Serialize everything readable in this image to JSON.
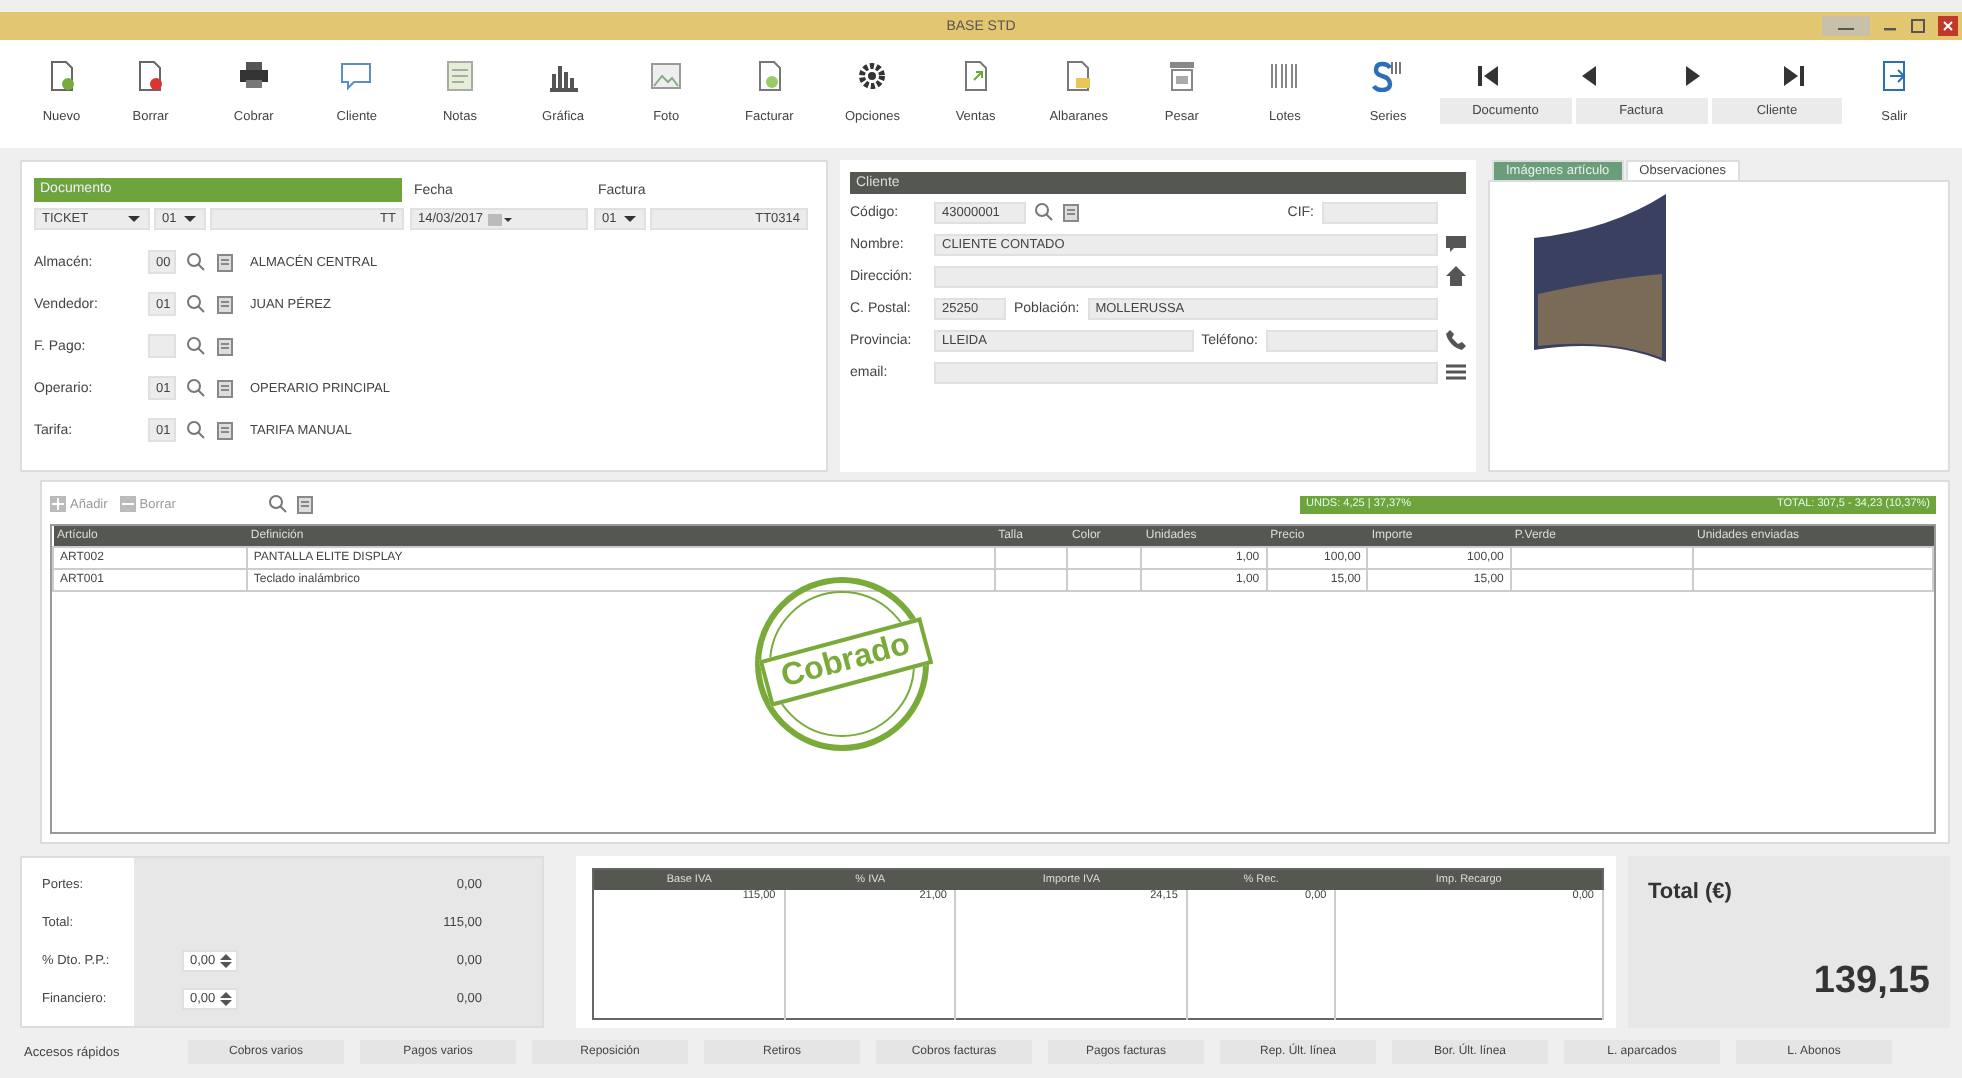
{
  "window": {
    "title": "BASE STD"
  },
  "toolbar": [
    "Nuevo",
    "Borrar",
    "Cobrar",
    "Cliente",
    "Notas",
    "Gráfica",
    "Foto",
    "Facturar",
    "Opciones",
    "Ventas",
    "Albaranes",
    "Pesar",
    "Lotes",
    "Series"
  ],
  "navigation": [
    "Documento",
    "Factura",
    "Cliente"
  ],
  "exit": "Salir",
  "document": {
    "header": "Documento",
    "date_label": "Fecha",
    "invoice_label": "Factura",
    "type": "TICKET",
    "series": "01",
    "prefix": "TT",
    "date": "14/03/2017",
    "invoice_series": "01",
    "invoice_number": "TT0314",
    "lookups": [
      {
        "label": "Almacén:",
        "code": "00",
        "name": "ALMACÉN CENTRAL"
      },
      {
        "label": "Vendedor:",
        "code": "01",
        "name": "JUAN PÉREZ"
      },
      {
        "label": "F. Pago:"
      },
      {
        "label": "Operario:",
        "code": "01",
        "name": "OPERARIO PRINCIPAL"
      },
      {
        "label": "Tarifa:",
        "code": "01",
        "name": "TARIFA MANUAL"
      }
    ]
  },
  "client": {
    "header": "Cliente",
    "code_label": "Código:",
    "code": "43000001",
    "cif_label": "CIF:",
    "name_label": "Nombre:",
    "name": "CLIENTE CONTADO",
    "address_label": "Dirección:",
    "postal_label": "C. Postal:",
    "postal": "25250",
    "town_label": "Población:",
    "town": "MOLLERUSSA",
    "province_label": "Provincia:",
    "province": "LLEIDA",
    "phone_label": "Teléfono:",
    "email_label": "email:"
  },
  "image_tabs": [
    {
      "label": "Imágenes artículo",
      "selected": true
    },
    {
      "label": "Observaciones",
      "selected": false
    }
  ],
  "lines": {
    "add": "Añadir",
    "delete": "Borrar",
    "summary_left": "UNDS: 4,25 | 37,37%",
    "summary_right": "TOTAL: 307,5 - 34,23 (10,37%)",
    "columns": [
      "Artículo",
      "Definición",
      "Talla",
      "Color",
      "Unidades",
      "Precio",
      "Importe",
      "P.Verde",
      "Unidades enviadas"
    ],
    "rows": [
      [
        "ART002",
        "PANTALLA ELITE DISPLAY",
        "",
        "",
        "1,00",
        "100,00",
        "100,00",
        "",
        ""
      ],
      [
        "ART001",
        "Teclado inalámbrico",
        "",
        "",
        "1,00",
        "15,00",
        "15,00",
        "",
        ""
      ]
    ],
    "stamp": "Cobrado"
  },
  "totals": {
    "rows": [
      {
        "label": "Portes:",
        "value": "0,00"
      },
      {
        "label": "Total:",
        "value": "115,00"
      },
      {
        "label": "% Dto. P.P.:",
        "input": "0,00",
        "value": "0,00"
      },
      {
        "label": "Financiero:",
        "input": "0,00",
        "value": "0,00"
      }
    ],
    "tax_columns": [
      "Base IVA",
      "% IVA",
      "Importe IVA",
      "% Rec.",
      "Imp. Recargo"
    ],
    "tax_rows": [
      [
        "115,00",
        "21,00",
        "24,15",
        "0,00",
        "0,00"
      ]
    ],
    "total_label": "Total (€)",
    "total": "139,15"
  },
  "quick_label": "Accesos rápidos",
  "quick_buttons": [
    "Cobros varios",
    "Pagos varios",
    "Reposición",
    "Retiros",
    "Cobros facturas",
    "Pagos facturas",
    "Rep. Últ. línea",
    "Bor. Últ. línea",
    "L. aparcados",
    "L. Abonos"
  ]
}
